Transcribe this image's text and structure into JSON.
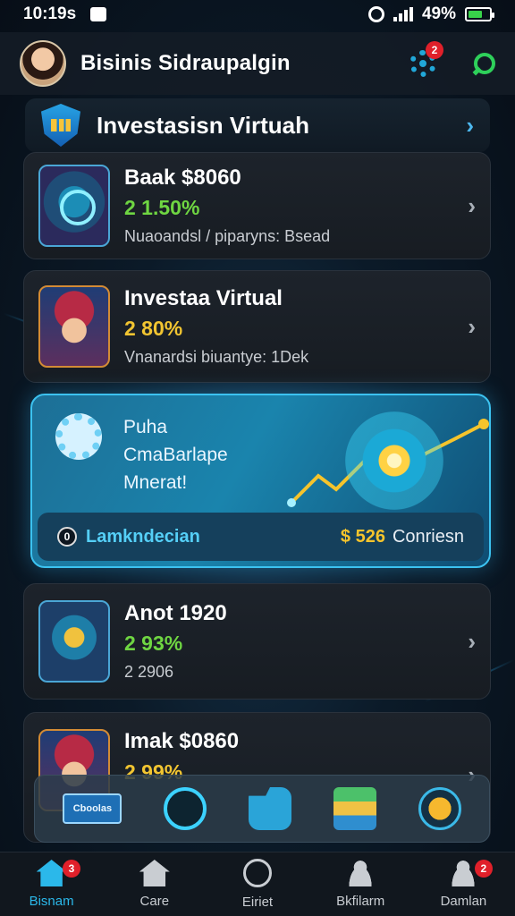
{
  "status_bar": {
    "time": "10:19s",
    "battery": "49%"
  },
  "header": {
    "title": "Bisinis Sidraupalgin",
    "settings_badge": "2"
  },
  "section": {
    "title": "Investasisn Virtuah"
  },
  "cards": [
    {
      "title": "Baak $8060",
      "percent": "2 1.50%",
      "subtitle": "Nuaoandsl / piparyns: Bsead",
      "thumb": "tech-globe-icon"
    },
    {
      "title": "Investaa Virtual",
      "percent": "2 80%",
      "subtitle": "Vnanardsi biuantye: 1Dek",
      "thumb": "investor-avatar"
    },
    {
      "title": "Anot 1920",
      "percent": "2 93%",
      "subtitle": "2 2906",
      "thumb": "gauge-icon"
    },
    {
      "title": "Imak $0860",
      "percent": "2 99%",
      "subtitle": "",
      "thumb": "investor-avatar"
    }
  ],
  "promo": {
    "line1": "Puha",
    "line2": "CmaBarlape",
    "line3": "Mnerat!",
    "left_pill": "Lamkndecian",
    "left_pill_icon": "0",
    "amount": "$ 526",
    "amount_label": "Conriesn"
  },
  "quick_actions": {
    "badge_button": "Cboolas"
  },
  "nav": {
    "items": [
      {
        "label": "Bisnam",
        "badge": "3"
      },
      {
        "label": "Care",
        "badge": ""
      },
      {
        "label": "Eiriet",
        "badge": ""
      },
      {
        "label": "Bkfilarm",
        "badge": ""
      },
      {
        "label": "Damlan",
        "badge": "2"
      }
    ]
  },
  "colors": {
    "accent": "#2bb8ea",
    "positive": "#6fd642",
    "warning": "#f2c531",
    "badge": "#e0202a"
  }
}
